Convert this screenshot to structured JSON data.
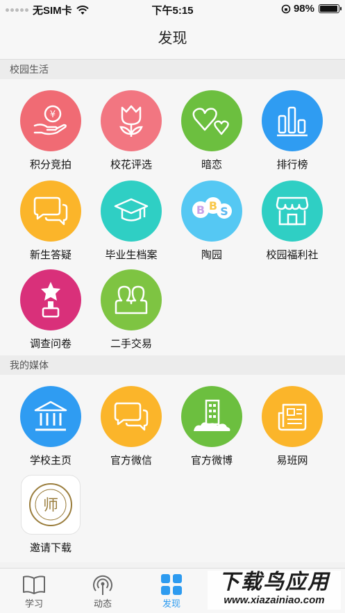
{
  "status_bar": {
    "carrier": "无SIM卡",
    "time": "下午5:15",
    "battery": "98%",
    "battery_level": 0.98
  },
  "nav": {
    "title": "发现"
  },
  "sections": [
    {
      "title": "校园生活",
      "items": [
        {
          "label": "积分竞拍",
          "color": "#f06b74",
          "icon": "coin-hand-icon"
        },
        {
          "label": "校花评选",
          "color": "#f27681",
          "icon": "tulip-icon"
        },
        {
          "label": "暗恋",
          "color": "#6cbf3f",
          "icon": "hearts-icon"
        },
        {
          "label": "排行榜",
          "color": "#2f9cf2",
          "icon": "bar-chart-icon"
        },
        {
          "label": "新生答疑",
          "color": "#fbb52a",
          "icon": "chat-bubbles-icon"
        },
        {
          "label": "毕业生档案",
          "color": "#2fcfc4",
          "icon": "graduation-cap-icon"
        },
        {
          "label": "陶园",
          "color": "#ffffff",
          "icon": "bbs-icon"
        },
        {
          "label": "校园福利社",
          "color": "#2fcfc4",
          "icon": "shop-icon"
        },
        {
          "label": "调查问卷",
          "color": "#d9307a",
          "icon": "trophy-icon"
        },
        {
          "label": "二手交易",
          "color": "#7ec442",
          "icon": "people-icon"
        }
      ]
    },
    {
      "title": "我的媒体",
      "items": [
        {
          "label": "学校主页",
          "color": "#2f9cf2",
          "icon": "school-building-icon"
        },
        {
          "label": "官方微信",
          "color": "#fbb52a",
          "icon": "chat-bubbles-icon"
        },
        {
          "label": "官方微博",
          "color": "#6cbf3f",
          "icon": "city-building-icon"
        },
        {
          "label": "易班网",
          "color": "#fbb52a",
          "icon": "newspaper-icon"
        },
        {
          "label": "邀请下载",
          "color": "#ffffff",
          "icon": "school-logo-icon",
          "logo_text": "师"
        }
      ]
    }
  ],
  "tabs": [
    {
      "label": "学习",
      "icon": "book-icon"
    },
    {
      "label": "动态",
      "icon": "broadcast-icon"
    },
    {
      "label": "发现",
      "icon": "grid-icon",
      "active": true
    }
  ],
  "watermark": {
    "line1": "下载鸟应用",
    "line2": "www.xiazainiao.com"
  }
}
